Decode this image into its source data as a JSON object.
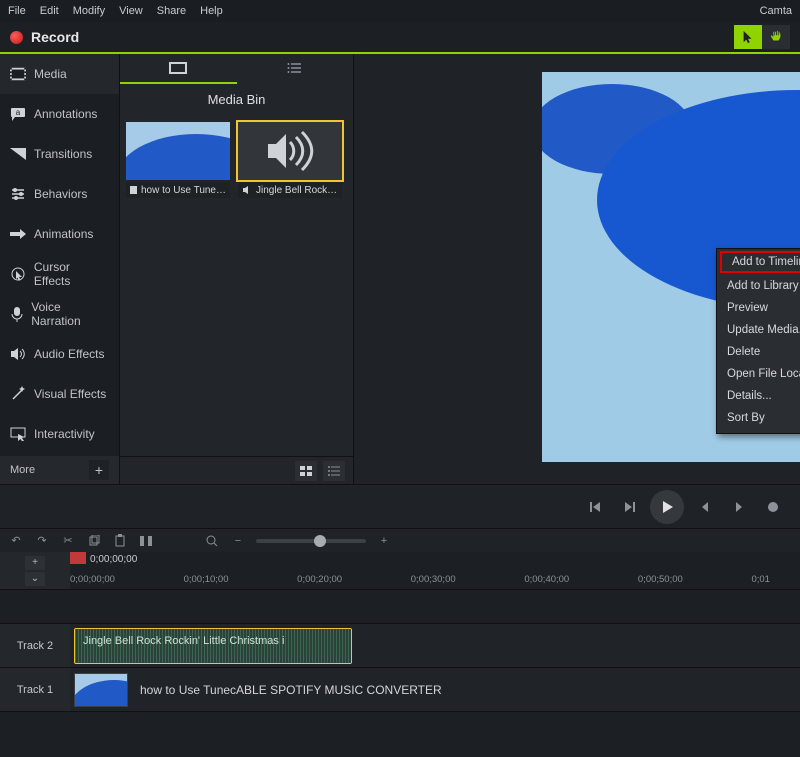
{
  "app_brand": "Camta",
  "menubar": [
    "File",
    "Edit",
    "Modify",
    "View",
    "Share",
    "Help"
  ],
  "record_label": "Record",
  "sidebar": {
    "items": [
      {
        "label": "Media"
      },
      {
        "label": "Annotations"
      },
      {
        "label": "Transitions"
      },
      {
        "label": "Behaviors"
      },
      {
        "label": "Animations"
      },
      {
        "label": "Cursor Effects"
      },
      {
        "label": "Voice Narration"
      },
      {
        "label": "Audio Effects"
      },
      {
        "label": "Visual Effects"
      },
      {
        "label": "Interactivity"
      }
    ],
    "more_label": "More"
  },
  "media_bin": {
    "title": "Media Bin",
    "items": [
      {
        "caption": "how to Use Tune…"
      },
      {
        "caption": "Jingle Bell Rock…"
      }
    ]
  },
  "context_menu": {
    "items": [
      "Add to Timeline at Playhead",
      "Add to Library",
      "Preview",
      "Update Media...",
      "Delete",
      "Open File Location...",
      "Details...",
      "Sort By"
    ]
  },
  "timeline": {
    "playhead_time": "0;00;00;00",
    "ruler": [
      "0;00;00;00",
      "0;00;10;00",
      "0;00;20;00",
      "0;00;30;00",
      "0;00;40;00",
      "0;00;50;00",
      "0;01"
    ],
    "tracks": [
      {
        "name": "Track 2",
        "clip_label": "Jingle Bell Rock Rockin' Little Christmas i"
      },
      {
        "name": "Track 1",
        "clip_label": "how to Use TunecABLE SPOTIFY MUSIC CONVERTER"
      }
    ]
  }
}
